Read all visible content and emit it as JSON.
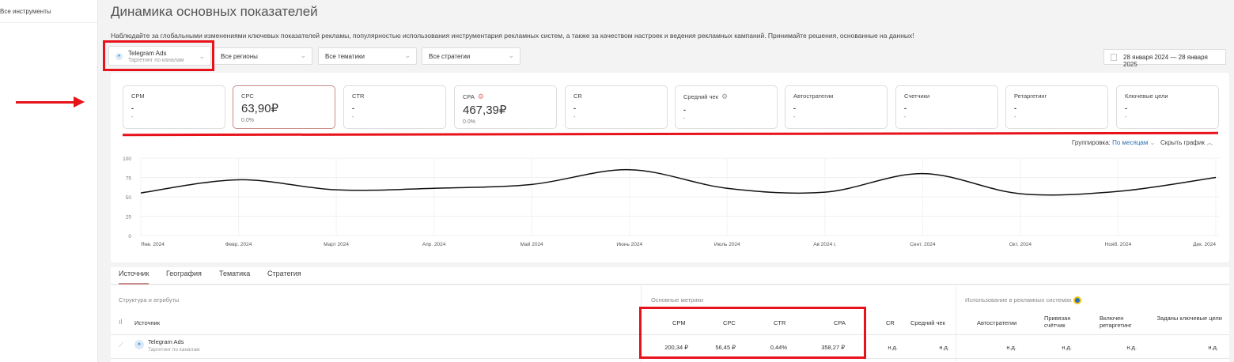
{
  "sidebar": {
    "all_tools": "Все инструменты"
  },
  "header": {
    "title": "Динамика основных показателей",
    "description": "Наблюдайте за глобальными изменениями ключевых показателей рекламы, популярностью использования инструментария рекламных систем, а также за качеством настроек и ведения рекламных кампаний. Принимайте решения, основанные на данных!"
  },
  "filters": {
    "source": {
      "label": "Telegram Ads",
      "sub": "Таргетинг по каналам"
    },
    "regions": "Все регионы",
    "topics": "Все тематики",
    "strategies": "Все стратегии",
    "date_range": "28 января 2024 — 28 января 2025"
  },
  "cards": [
    {
      "label": "CPM",
      "value": "-",
      "change": "-"
    },
    {
      "label": "CPC",
      "value": "63,90₽",
      "change": "0.0%"
    },
    {
      "label": "CTR",
      "value": "-",
      "change": "-"
    },
    {
      "label": "CPA",
      "value": "467,39₽",
      "change": "0.0%"
    },
    {
      "label": "CR",
      "value": "-",
      "change": "-"
    },
    {
      "label": "Средний чек",
      "value": "-",
      "change": "-"
    },
    {
      "label": "Автостратегии",
      "value": "-",
      "change": "-"
    },
    {
      "label": "Счетчики",
      "value": "-",
      "change": "-"
    },
    {
      "label": "Ретаргетинг",
      "value": "-",
      "change": "-"
    },
    {
      "label": "Ключевые цели",
      "value": "-",
      "change": "-"
    }
  ],
  "chart_controls": {
    "grouping_label": "Группировка:",
    "grouping_value": "По месяцам",
    "hide_chart": "Скрыть график"
  },
  "chart_data": {
    "type": "line",
    "categories": [
      "Янв. 2024",
      "Февр. 2024",
      "Март 2024",
      "Апр. 2024",
      "Май 2024",
      "Июнь 2024",
      "Июль 2024",
      "Ав 2024 г.",
      "Сент. 2024",
      "Окт. 2024",
      "Нояб. 2024",
      "Дек. 2024"
    ],
    "values": [
      55,
      72,
      59,
      61,
      66,
      85,
      61,
      56,
      80,
      54,
      57,
      75
    ],
    "yticks": [
      "0",
      "25",
      "50",
      "75",
      "100"
    ],
    "ylim": [
      0,
      100
    ],
    "grid": true,
    "line_color": "#111111"
  },
  "tabs": [
    "Источник",
    "География",
    "Тематика",
    "Стратегия"
  ],
  "table": {
    "groups": {
      "structure": "Структура и атрибуты",
      "metrics": "Основные метрики",
      "usage": "Использование в рекламных системах"
    },
    "headers": {
      "source": "Источник",
      "cpm": "CPM",
      "cpc": "CPC",
      "ctr": "CTR",
      "cpa": "CPA",
      "cr": "CR",
      "avg_check": "Средний чек",
      "autostrategies": "Автостратегии",
      "counter": "Привязан счётчик",
      "retargeting": "Включен ретаргетинг",
      "goals": "Заданы ключевые цели"
    },
    "rows": [
      {
        "name": "Telegram Ads",
        "sub": "Таргетинг по каналам",
        "cpm": "200,34 ₽",
        "cpc": "56,45 ₽",
        "ctr": "0,44%",
        "cpa": "358,27 ₽",
        "cr": "н.д.",
        "avg_check": "н.д.",
        "autostrategies": "н.д.",
        "counter": "н.д.",
        "retargeting": "н.д.",
        "goals": "н.д."
      }
    ]
  },
  "colors": {
    "annotation": "#e8121a",
    "accent": "#c98a8a"
  }
}
